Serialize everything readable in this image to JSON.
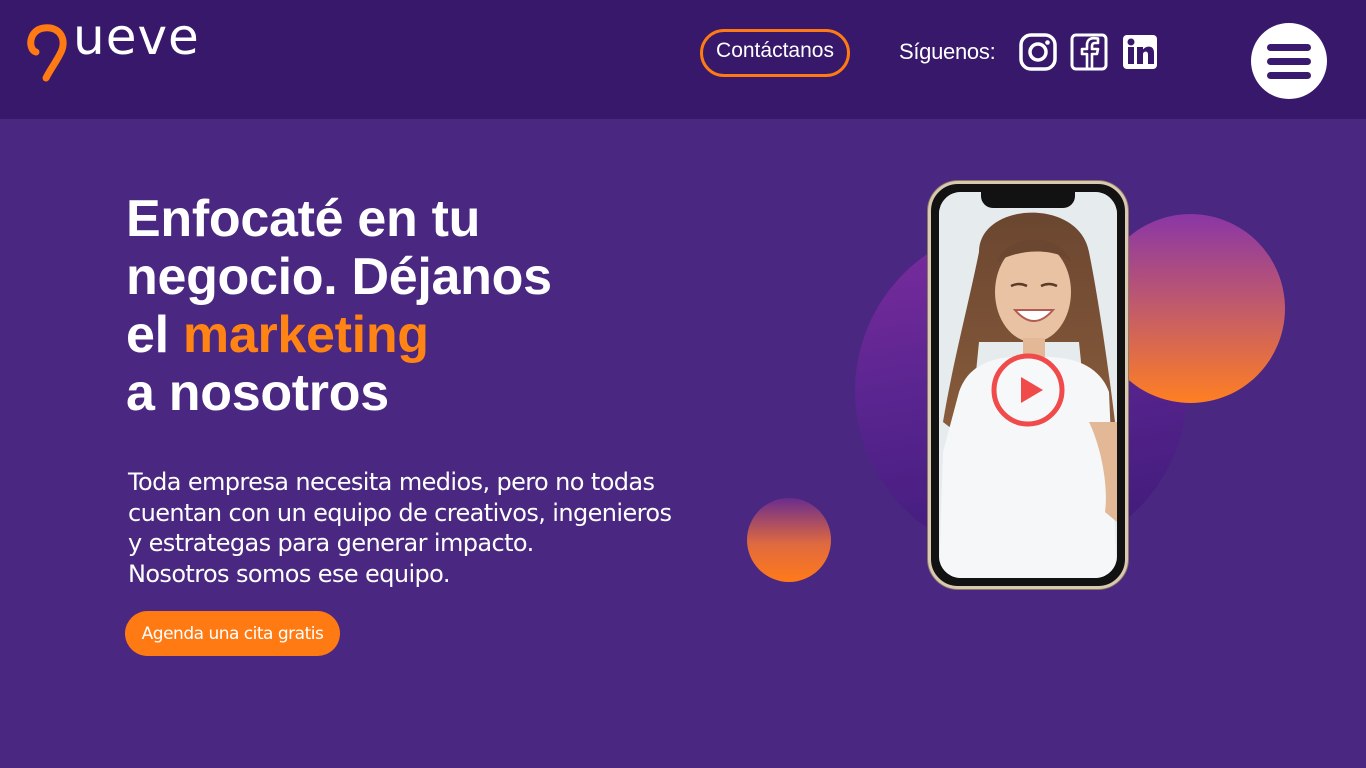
{
  "brand": {
    "name": "ueve"
  },
  "header": {
    "contact_label": "Contáctanos",
    "follow_label": "Síguenos:",
    "social": [
      {
        "name": "instagram-icon"
      },
      {
        "name": "facebook-icon"
      },
      {
        "name": "linkedin-icon"
      }
    ]
  },
  "hero": {
    "headline": {
      "line1": "Enfocaté en tu",
      "line2": "negocio. Déjanos",
      "line3_prefix": "el ",
      "line3_accent": "marketing",
      "line4": "a nosotros"
    },
    "description": {
      "line1": "Toda empresa necesita medios, pero no todas",
      "line2": "cuentan con un equipo de creativos, ingenieros",
      "line3": "y estrategas para generar impacto.",
      "line4": "Nosotros somos ese equipo."
    },
    "cta_label": "Agenda una cita gratis"
  },
  "colors": {
    "background": "#4a2780",
    "header": "#37186b",
    "accent": "#ff7a12",
    "play": "#f04a4a"
  }
}
